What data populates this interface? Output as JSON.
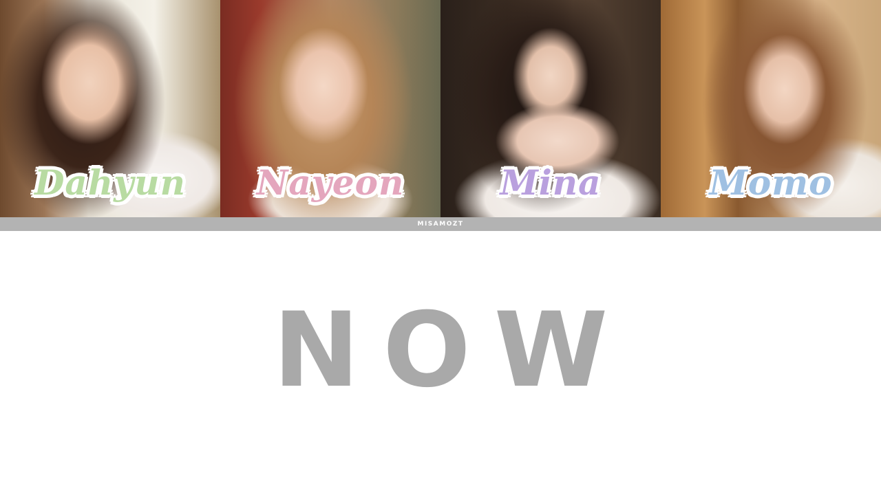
{
  "members": [
    {
      "name": "Dahyun",
      "color": "#b8dba2"
    },
    {
      "name": "Nayeon",
      "color": "#e4a6bd"
    },
    {
      "name": "Mina",
      "color": "#b9a0de"
    },
    {
      "name": "Momo",
      "color": "#9fc0e2"
    }
  ],
  "watermark": "MISAMOZT",
  "lyric": {
    "text": "NOW",
    "color": "#a9a9a9"
  },
  "strip_color": "#b3b3b3"
}
